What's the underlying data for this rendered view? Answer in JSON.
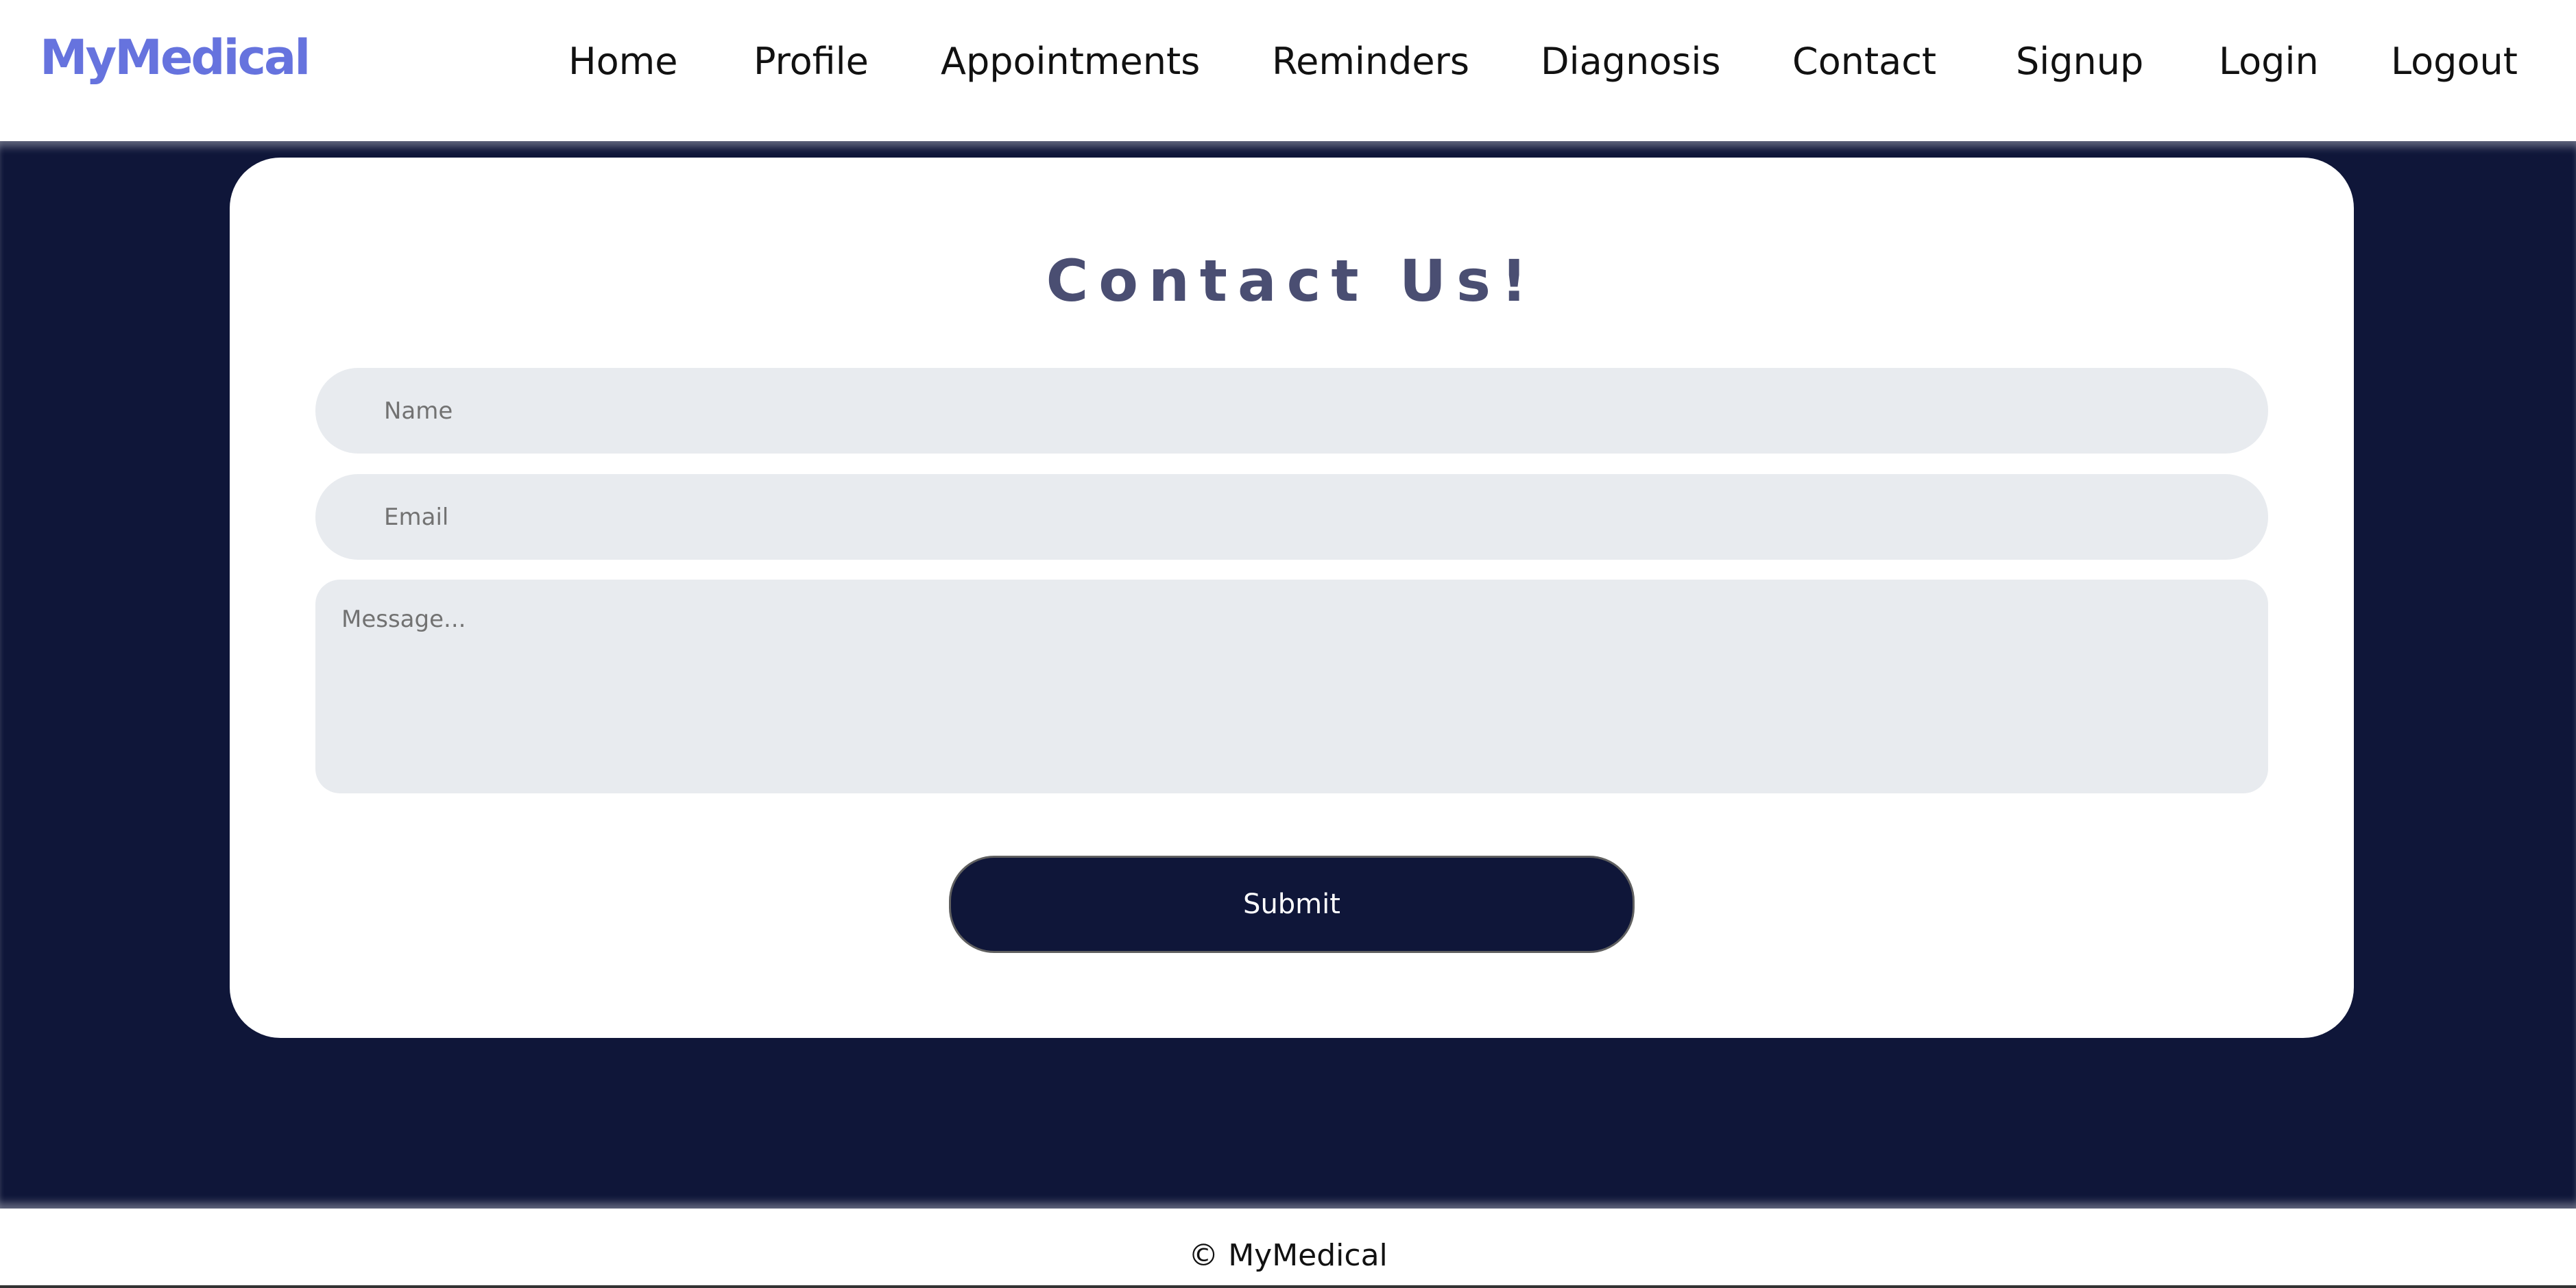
{
  "brand": {
    "logo": "MyMedical",
    "color": "#6673de"
  },
  "nav": {
    "items": [
      {
        "label": "Home"
      },
      {
        "label": "Profile"
      },
      {
        "label": "Appointments"
      },
      {
        "label": "Reminders"
      },
      {
        "label": "Diagnosis"
      },
      {
        "label": "Contact"
      },
      {
        "label": "Signup"
      },
      {
        "label": "Login"
      },
      {
        "label": "Logout"
      }
    ]
  },
  "contact": {
    "title": "Contact Us!",
    "name_placeholder": "Name",
    "name_value": "",
    "email_placeholder": "Email",
    "email_value": "",
    "message_placeholder": "Message...",
    "message_value": "",
    "submit_label": "Submit"
  },
  "footer": {
    "text": "© MyMedical"
  },
  "colors": {
    "background": "#0f1639",
    "card": "#ffffff",
    "input": "#e8ebef",
    "title": "#4a4e72",
    "button": "#0f1639"
  }
}
